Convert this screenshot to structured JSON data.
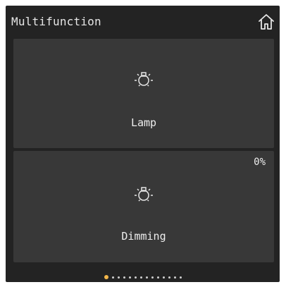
{
  "header": {
    "title": "Multifunction",
    "home_icon": "home-icon"
  },
  "tiles": [
    {
      "label": "Lamp",
      "icon": "lightbulb-icon"
    },
    {
      "label": "Dimming",
      "icon": "lightbulb-icon",
      "level": "0%"
    }
  ],
  "pager": {
    "pages": 14,
    "active_index": 0,
    "active_color": "#f2b64a",
    "inactive_color": "#cfcfcf"
  },
  "colors": {
    "background": "#232323",
    "tile": "#383838",
    "text": "#eeeeee"
  }
}
